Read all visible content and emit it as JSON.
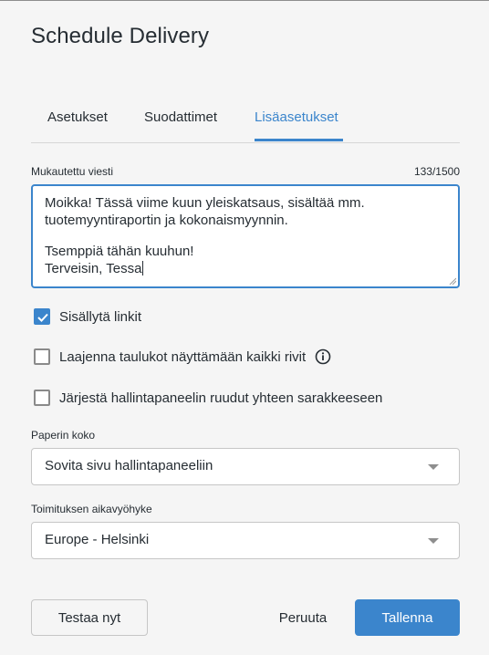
{
  "dialog": {
    "title": "Schedule Delivery"
  },
  "tabs": [
    {
      "label": "Asetukset",
      "active": false
    },
    {
      "label": "Suodattimet",
      "active": false
    },
    {
      "label": "Lisäasetukset",
      "active": true
    }
  ],
  "custom_message": {
    "label": "Mukautettu viesti",
    "counter": "133/1500",
    "lines": [
      "Moikka! Tässä viime kuun yleiskatsaus, sisältää mm.",
      "tuotemyyntiraportin ja kokonaismyynnin.",
      "",
      "Tsemppiä tähän kuuhun!",
      "Terveisin, Tessa"
    ]
  },
  "options": [
    {
      "label": "Sisällytä linkit",
      "checked": true
    },
    {
      "label": "Laajenna taulukot näyttämään kaikki rivit",
      "checked": false,
      "icon": "info-icon"
    },
    {
      "label": "Järjestä hallintapaneelin ruudut yhteen sarakkeeseen",
      "checked": false
    }
  ],
  "paper_size": {
    "label": "Paperin koko",
    "value": "Sovita sivu hallintapaneeliin"
  },
  "timezone": {
    "label": "Toimituksen aikavyöhyke",
    "value": "Europe - Helsinki"
  },
  "footer": {
    "test_label": "Testaa nyt",
    "cancel_label": "Peruuta",
    "save_label": "Tallenna"
  },
  "colors": {
    "accent": "#3b85cc",
    "text": "#262d33",
    "background": "#f5f5f5",
    "border": "#c6c6c6"
  }
}
